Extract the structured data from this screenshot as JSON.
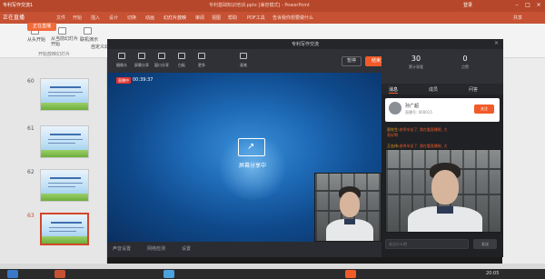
{
  "overlay": {
    "title": "专利写作交流1",
    "live_label": "正在直播",
    "badge": "正在直播"
  },
  "ppt": {
    "doc_title": "专利基础知识培训.pptx [兼容模式] - PowerPoint",
    "user": "登录",
    "tabs": [
      "文件",
      "开始",
      "插入",
      "设计",
      "切换",
      "动画",
      "幻灯片放映",
      "审阅",
      "视图",
      "帮助",
      "PDF工具",
      "告诉我你想要做什么",
      "共享"
    ],
    "ribbon": {
      "from_start": "从头开始",
      "from_current": "从当前幻灯片开始",
      "online_present": "联机演示",
      "custom_show": "自定义幻灯片放映",
      "group_label": "开始放映幻灯片"
    },
    "thumbnails": [
      {
        "num": "60"
      },
      {
        "num": "61"
      },
      {
        "num": "62"
      },
      {
        "num": "63"
      }
    ]
  },
  "live": {
    "window_title": "专利写作交流",
    "toolbar": [
      {
        "label": "摄像头",
        "icon": "camera-icon"
      },
      {
        "label": "屏幕分享",
        "icon": "screen-share-icon"
      },
      {
        "label": "窗口分享",
        "icon": "window-icon"
      },
      {
        "label": "白板",
        "icon": "whiteboard-icon"
      },
      {
        "label": "更多",
        "icon": "more-icon"
      },
      {
        "label": "画笔",
        "icon": "pen-icon"
      }
    ],
    "pause_label": "暂停",
    "start_label": "结束直播",
    "rec_tag": "直播中",
    "rec_time": "00:39:37",
    "share_label": "屏幕分享中",
    "bottom": [
      "声音设置",
      "网络检测",
      "设置"
    ],
    "stats": [
      {
        "value": "30",
        "label": "累计观看"
      },
      {
        "value": "0",
        "label": "点赞"
      }
    ],
    "side_tabs": [
      "消息",
      "成员",
      "问答"
    ],
    "anchor": {
      "name": "孙广超",
      "sub": "直播号: 000015",
      "follow": "关注"
    },
    "chat": [
      {
        "who": "邵先生:",
        "msg": "老师辛苦了, 我在看直播呢, 大"
      },
      {
        "who": "",
        "msg": "家好啊"
      },
      {
        "who": "王志伟:",
        "msg": "老师辛苦了, 我在看直播呢, 大"
      },
      {
        "who": "",
        "msg": "家好啊"
      }
    ],
    "input_placeholder": "说点什么吧",
    "send_label": "发送"
  },
  "taskbar": {
    "time": "20:05"
  }
}
